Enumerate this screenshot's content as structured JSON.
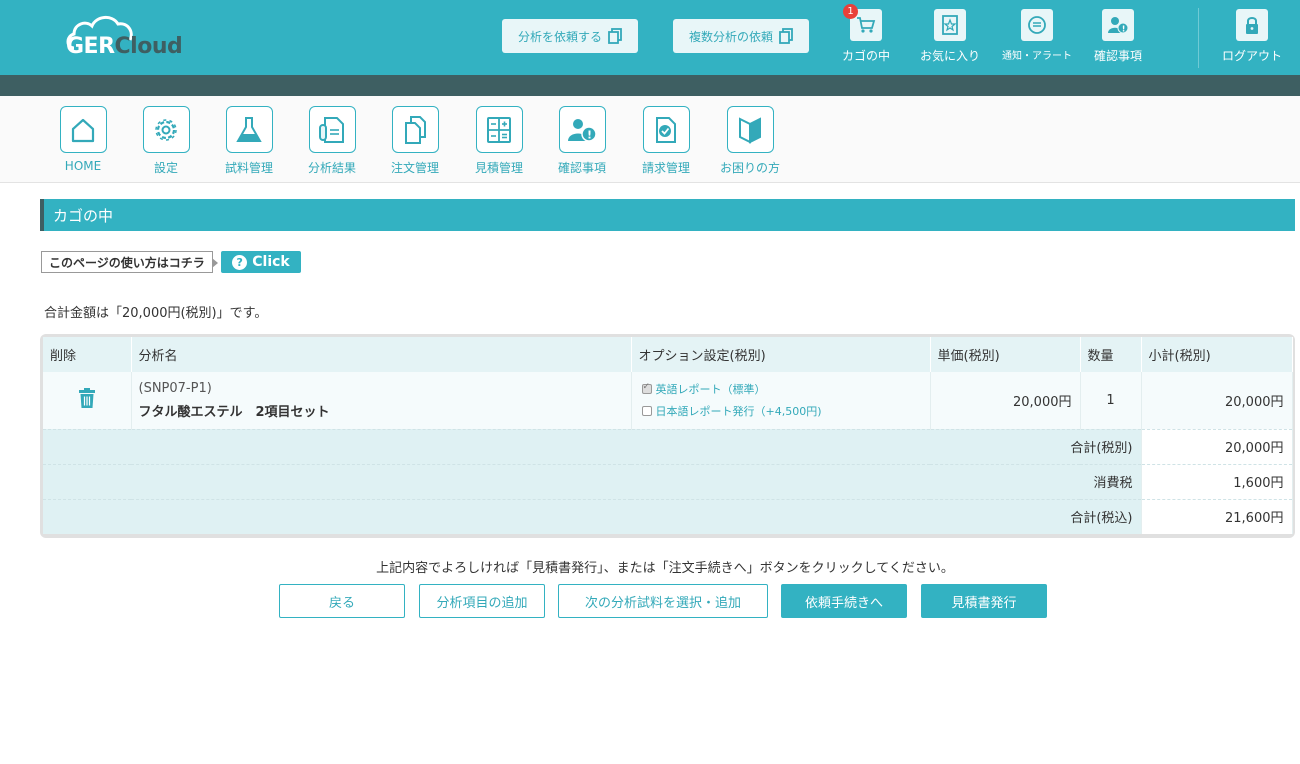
{
  "logo": {
    "part1": "GER",
    "part2": "Cloud"
  },
  "header": {
    "request_analysis": "分析を依頼する",
    "request_multiple": "複数分析の依頼",
    "nav": [
      {
        "label": "カゴの中",
        "icon": "cart-icon",
        "badge": "1"
      },
      {
        "label": "お気に入り",
        "icon": "favorite-icon"
      },
      {
        "label": "通知・アラート",
        "icon": "notification-icon"
      },
      {
        "label": "確認事項",
        "icon": "confirm-icon"
      },
      {
        "label": "ログアウト",
        "icon": "lock-icon"
      }
    ]
  },
  "menu": [
    {
      "label": "HOME",
      "icon": "home-icon"
    },
    {
      "label": "設定",
      "icon": "gear-icon"
    },
    {
      "label": "試料管理",
      "icon": "flask-icon"
    },
    {
      "label": "分析結果",
      "icon": "test-tube-document-icon"
    },
    {
      "label": "注文管理",
      "icon": "documents-icon"
    },
    {
      "label": "見積管理",
      "icon": "calculator-icon"
    },
    {
      "label": "確認事項",
      "icon": "user-alert-icon"
    },
    {
      "label": "請求管理",
      "icon": "invoice-check-icon"
    },
    {
      "label": "お困りの方",
      "icon": "beginner-mark-icon"
    }
  ],
  "page": {
    "title": "カゴの中",
    "help_text": "このページの使い方はコチラ",
    "click_label": "Click",
    "total_note": "合計金額は「20,000円(税別)」です。"
  },
  "table": {
    "headers": {
      "delete": "削除",
      "name": "分析名",
      "options": "オプション設定(税別)",
      "unit_price": "単価(税別)",
      "qty": "数量",
      "subtotal": "小計(税別)"
    },
    "rows": [
      {
        "code": "(SNP07-P1)",
        "name": "フタル酸エステル　2項目セット",
        "options": [
          {
            "label": "英語レポート（標準）",
            "checked": true
          },
          {
            "label": "日本語レポート発行（+4,500円)",
            "checked": false
          }
        ],
        "unit_price": "20,000円",
        "qty": "1",
        "subtotal": "20,000円"
      }
    ],
    "summary": [
      {
        "label": "合計(税別)",
        "value": "20,000円"
      },
      {
        "label": "消費税",
        "value": "1,600円"
      },
      {
        "label": "合計(税込)",
        "value": "21,600円"
      }
    ]
  },
  "instruction": "上記内容でよろしければ「見積書発行」、または「注文手続きへ」ボタンをクリックしてください。",
  "buttons": {
    "back": "戻る",
    "add_item": "分析項目の追加",
    "next_sample": "次の分析試料を選択・追加",
    "proceed": "依頼手続きへ",
    "estimate": "見積書発行"
  },
  "colors": {
    "accent": "#33b2c2",
    "dark_strip": "#3e5f62",
    "badge": "#e8413b"
  }
}
